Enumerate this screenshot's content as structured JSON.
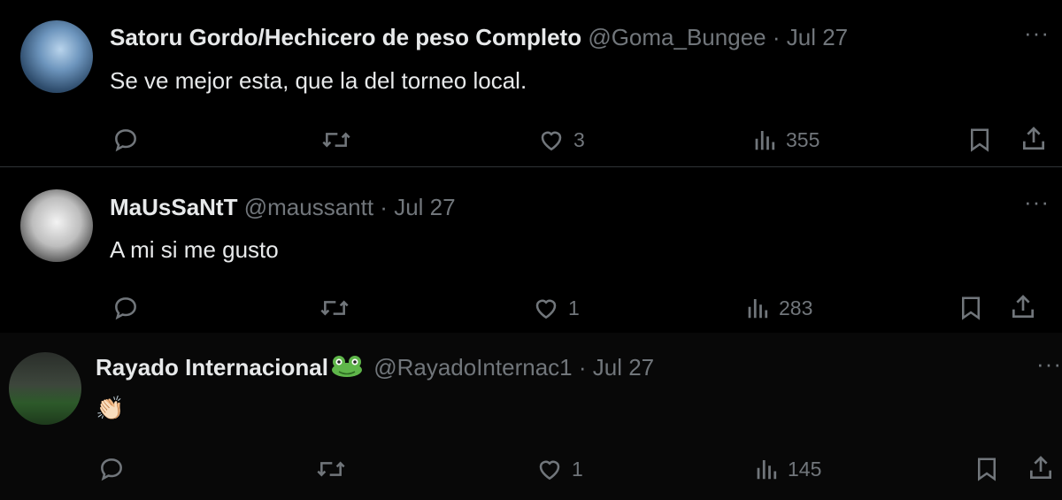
{
  "tweets": [
    {
      "name": "Satoru Gordo/Hechicero de peso Completo",
      "handle": "@Goma_Bungee",
      "separator": "·",
      "date": "Jul 27",
      "text": "Se ve mejor esta, que la del torneo local.",
      "likes": "3",
      "views": "355",
      "more": "···"
    },
    {
      "name": "MaUsSaNtT",
      "handle": "@maussantt",
      "separator": "·",
      "date": "Jul 27",
      "text": "A mi si me gusto",
      "likes": "1",
      "views": "283",
      "more": "···"
    },
    {
      "name": "Rayado Internacional",
      "handle": "@RayadoInternac1",
      "separator": "·",
      "date": "Jul 27",
      "text": "👏🏻",
      "likes": "1",
      "views": "145",
      "more": "···"
    }
  ],
  "colors": {
    "background": "#000000",
    "text": "#e7e9ea",
    "muted": "#71767b",
    "divider": "#2f3336"
  },
  "icons": [
    "reply-icon",
    "retweet-icon",
    "like-icon",
    "views-icon",
    "bookmark-icon",
    "share-icon",
    "frog-emoji-icon"
  ]
}
